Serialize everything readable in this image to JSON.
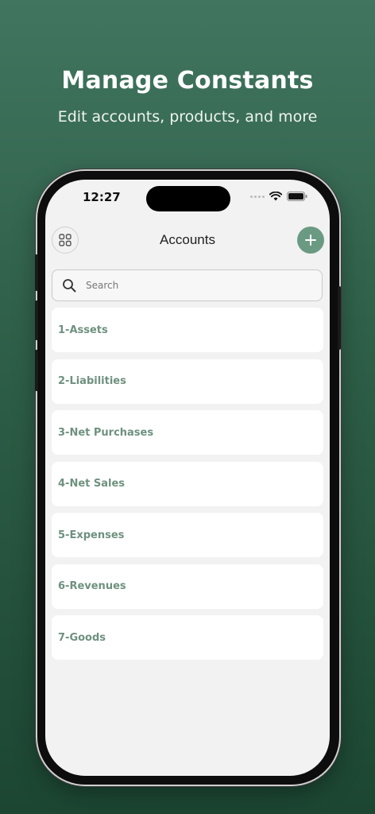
{
  "promo": {
    "headline": "Manage Constants",
    "subheadline": "Edit accounts, products, and more"
  },
  "status_bar": {
    "time": "12:27",
    "icons": [
      "cellular-dots-icon",
      "wifi-icon",
      "battery-icon"
    ]
  },
  "header": {
    "title": "Accounts",
    "left_icon": "grid-icon",
    "right_icon": "plus-icon"
  },
  "search": {
    "placeholder": "Search",
    "value": ""
  },
  "accounts": [
    {
      "label": "1-Assets"
    },
    {
      "label": "2-Liabilities"
    },
    {
      "label": "3-Net Purchases"
    },
    {
      "label": "4-Net Sales"
    },
    {
      "label": "5-Expenses"
    },
    {
      "label": "6-Revenues"
    },
    {
      "label": "7-Goods"
    }
  ],
  "colors": {
    "background_top": "#41755f",
    "background_bottom": "#1c4632",
    "accent": "#6b9a83",
    "item_text": "#6e917f"
  }
}
